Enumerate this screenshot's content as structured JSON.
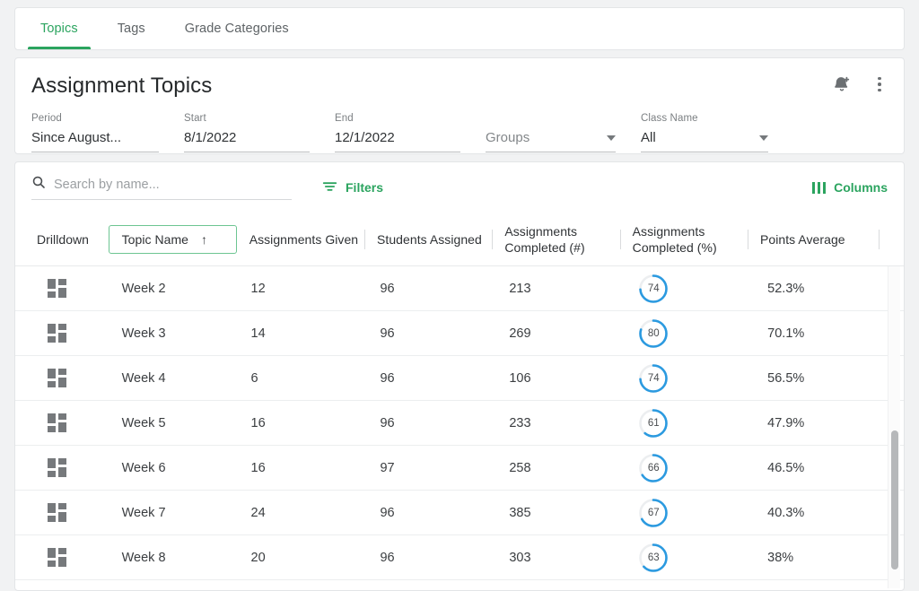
{
  "theme": {
    "accent_green": "#2ba45f",
    "ring_blue": "#2b9ae0",
    "ring_track": "#eceef0",
    "page_bg": "#f1f2f3"
  },
  "tabs": [
    {
      "label": "Topics",
      "active": true
    },
    {
      "label": "Tags",
      "active": false
    },
    {
      "label": "Grade Categories",
      "active": false
    }
  ],
  "header": {
    "title": "Assignment Topics",
    "alert_icon": "bell-add-icon",
    "menu_icon": "kebab-menu-icon",
    "fields": [
      {
        "label": "Period",
        "value": "Since August...",
        "type": "text",
        "is_placeholder": false
      },
      {
        "label": "Start",
        "value": "8/1/2022",
        "type": "text",
        "is_placeholder": false
      },
      {
        "label": "End",
        "value": "12/1/2022",
        "type": "text",
        "is_placeholder": false
      },
      {
        "label": "",
        "value": "Groups",
        "type": "select",
        "is_placeholder": true
      },
      {
        "label": "Class Name",
        "value": "All",
        "type": "select",
        "is_placeholder": false
      }
    ]
  },
  "toolbar": {
    "search_placeholder": "Search by name...",
    "search_value": "",
    "search_icon": "search-icon",
    "filters_label": "Filters",
    "filters_icon": "filter-icon",
    "columns_label": "Columns",
    "columns_icon": "columns-icon"
  },
  "table": {
    "sort": {
      "column": "Topic Name",
      "direction": "asc",
      "arrow": "↑"
    },
    "columns": [
      {
        "key": "drilldown",
        "label": "Drilldown",
        "divider": false,
        "sorted": false
      },
      {
        "key": "topic",
        "label": "Topic Name",
        "divider": false,
        "sorted": true
      },
      {
        "key": "given",
        "label": "Assignments Given",
        "divider": false,
        "sorted": false
      },
      {
        "key": "students",
        "label": "Students Assigned",
        "divider": true,
        "sorted": false
      },
      {
        "key": "completed_num",
        "label": "Assignments Completed (#)",
        "divider": true,
        "sorted": false
      },
      {
        "key": "completed_pct",
        "label": "Assignments Completed (%)",
        "divider": true,
        "sorted": false
      },
      {
        "key": "points_avg",
        "label": "Points Average",
        "divider": true,
        "sorted": false
      }
    ],
    "rows": [
      {
        "drilldown_icon": "drilldown-grid-icon",
        "topic": "Week 2",
        "given": "12",
        "students": "96",
        "completed_num": "213",
        "completed_pct": "74",
        "points_avg": "52.3%"
      },
      {
        "drilldown_icon": "drilldown-grid-icon",
        "topic": "Week 3",
        "given": "14",
        "students": "96",
        "completed_num": "269",
        "completed_pct": "80",
        "points_avg": "70.1%"
      },
      {
        "drilldown_icon": "drilldown-grid-icon",
        "topic": "Week 4",
        "given": "6",
        "students": "96",
        "completed_num": "106",
        "completed_pct": "74",
        "points_avg": "56.5%"
      },
      {
        "drilldown_icon": "drilldown-grid-icon",
        "topic": "Week 5",
        "given": "16",
        "students": "96",
        "completed_num": "233",
        "completed_pct": "61",
        "points_avg": "47.9%"
      },
      {
        "drilldown_icon": "drilldown-grid-icon",
        "topic": "Week 6",
        "given": "16",
        "students": "97",
        "completed_num": "258",
        "completed_pct": "66",
        "points_avg": "46.5%"
      },
      {
        "drilldown_icon": "drilldown-grid-icon",
        "topic": "Week 7",
        "given": "24",
        "students": "96",
        "completed_num": "385",
        "completed_pct": "67",
        "points_avg": "40.3%"
      },
      {
        "drilldown_icon": "drilldown-grid-icon",
        "topic": "Week 8",
        "given": "20",
        "students": "96",
        "completed_num": "303",
        "completed_pct": "63",
        "points_avg": "38%"
      }
    ]
  }
}
